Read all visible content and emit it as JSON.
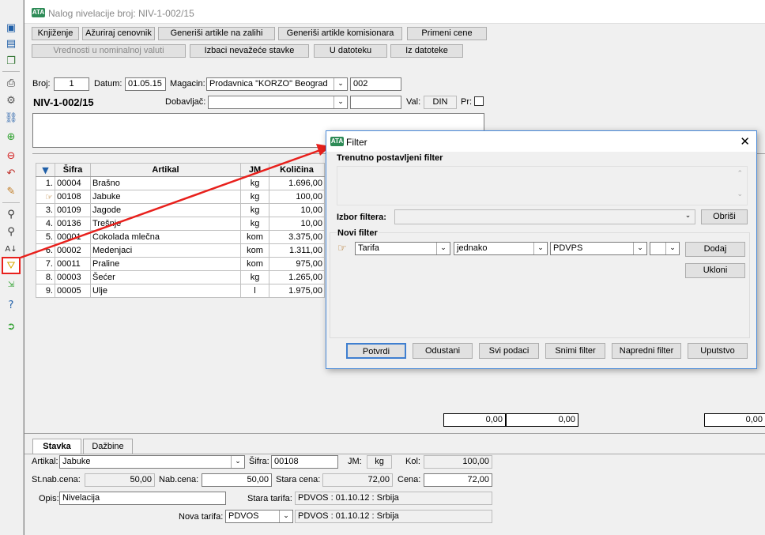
{
  "window": {
    "title": "Nalog nivelacije broj: NIV-1-002/15",
    "logo": "ATA"
  },
  "toolbar_icons": [
    "save-icon",
    "save-as-icon",
    "copy-icon",
    "print-icon",
    "tools-icon",
    "link-icon",
    "add-icon",
    "delete-icon",
    "undo-icon",
    "edit-icon",
    "find-icon",
    "find-next-icon",
    "sort-icon",
    "filter-icon",
    "expand-icon",
    "help-icon",
    "exit-icon"
  ],
  "buttons": {
    "knjizenje": "Knjiženje",
    "azuriraj": "Ažuriraj cenovnik",
    "generisi_zalihi": "Generiši artikle na zalihi",
    "generisi_komisionara": "Generiši artikle komisionara",
    "primeni_cene": "Primeni cene",
    "vrednosti": "Vrednosti u nominalnoj valuti",
    "izbaci": "Izbaci nevažeće stavke",
    "u_datoteku": "U datoteku",
    "iz_datoteke": "Iz datoteke"
  },
  "header": {
    "broj_label": "Broj:",
    "broj": "1",
    "datum_label": "Datum:",
    "datum": "01.05.15",
    "magacin_label": "Magacin:",
    "magacin": "Prodavnica \"KORZO\" Beograd",
    "magacin_code": "002",
    "doc_no": "NIV-1-002/15",
    "dobavljac_label": "Dobavljač:",
    "dobavljac": "",
    "dobavljac_code": "",
    "val_label": "Val:",
    "val": "DIN",
    "pr_label": "Pr:"
  },
  "grid": {
    "columns": [
      "Šifra",
      "Artikal",
      "JM",
      "Količina"
    ],
    "rows": [
      {
        "no": "1.",
        "sifra": "00004",
        "artikal": "Brašno",
        "jm": "kg",
        "kolicina": "1.696,00"
      },
      {
        "no": "",
        "sifra": "00108",
        "artikal": "Jabuke",
        "jm": "kg",
        "kolicina": "100,00"
      },
      {
        "no": "3.",
        "sifra": "00109",
        "artikal": "Jagode",
        "jm": "kg",
        "kolicina": "10,00"
      },
      {
        "no": "4.",
        "sifra": "00136",
        "artikal": "Trešnje",
        "jm": "kg",
        "kolicina": "10,00"
      },
      {
        "no": "5.",
        "sifra": "00001",
        "artikal": "Cokolada mlečna",
        "jm": "kom",
        "kolicina": "3.375,00"
      },
      {
        "no": "6.",
        "sifra": "00002",
        "artikal": "Medenjaci",
        "jm": "kom",
        "kolicina": "1.311,00"
      },
      {
        "no": "7.",
        "sifra": "00011",
        "artikal": "Praline",
        "jm": "kom",
        "kolicina": "975,00"
      },
      {
        "no": "8.",
        "sifra": "00003",
        "artikal": "Šećer",
        "jm": "kg",
        "kolicina": "1.265,00"
      },
      {
        "no": "9.",
        "sifra": "00005",
        "artikal": "Ulje",
        "jm": "l",
        "kolicina": "1.975,00"
      }
    ]
  },
  "totals": [
    "0,00",
    "0,00",
    "0,00"
  ],
  "tabs": [
    "Stavka",
    "Dažbine"
  ],
  "stavka": {
    "artikal_label": "Artikal:",
    "artikal": "Jabuke",
    "sifra_label": "Šifra:",
    "sifra": "00108",
    "jm_label": "JM:",
    "jm": "kg",
    "kol_label": "Kol:",
    "kol": "100,00",
    "stnab_label": "St.nab.cena:",
    "stnab": "50,00",
    "nab_label": "Nab.cena:",
    "nab": "50,00",
    "stara_label": "Stara cena:",
    "stara": "72,00",
    "cena_label": "Cena:",
    "cena": "72,00",
    "opis_label": "Opis:",
    "opis": "Nivelacija",
    "stara_tarifa_label": "Stara tarifa:",
    "stara_tarifa": "PDVOS : 01.10.12 : Srbija",
    "nova_tarifa_label": "Nova tarifa:",
    "nova_tarifa": "PDVOS",
    "nova_tarifa_desc": "PDVOS : 01.10.12 : Srbija"
  },
  "filter_dialog": {
    "title": "Filter",
    "current_label": "Trenutno postavljeni filter",
    "izbor_label": "Izbor filtera:",
    "obrisi": "Obriši",
    "novi_label": "Novi filter",
    "field": "Tarifa",
    "operator": "jednako",
    "value": "PDVPS",
    "extra": "",
    "dodaj": "Dodaj",
    "ukloni": "Ukloni",
    "potvrdi": "Potvrdi",
    "odustani": "Odustani",
    "svi": "Svi podaci",
    "snimi": "Snimi filter",
    "napredni": "Napredni filter",
    "uputstvo": "Uputstvo"
  },
  "colors": {
    "arrow": "#e8201c",
    "highlight": "#e8201c",
    "dialog_border": "#4a8ad9"
  }
}
